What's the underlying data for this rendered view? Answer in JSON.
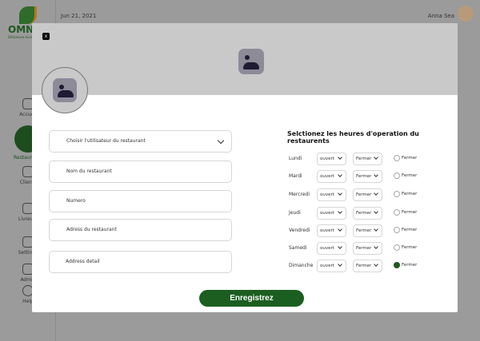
{
  "brand": {
    "name": "OMNIFOOD",
    "tagline": "Délicieuse livraison"
  },
  "sidebar": {
    "items": [
      {
        "label": "Accueil"
      },
      {
        "label": "Restaurants"
      },
      {
        "label": "Clients"
      },
      {
        "label": "Livreurs"
      },
      {
        "label": "Settings"
      },
      {
        "label": "Admin"
      },
      {
        "label": "Help"
      }
    ]
  },
  "topbar": {
    "date": "Jun 21, 2021",
    "user": "Anna Sea"
  },
  "modal": {
    "close_label": "x",
    "fields": [
      {
        "label": "Choisir l'utilisateur du restaurant",
        "dropdown": true
      },
      {
        "label": "Nom du restaurant"
      },
      {
        "label": "Numero"
      },
      {
        "label": "Adress du restaurant"
      },
      {
        "label": "Address detail"
      }
    ],
    "hours_title": "Selctionez les heures d'operation du restaurents",
    "days": [
      {
        "day": "Lundi",
        "open": "ouvert",
        "close": "Fermer",
        "closed_label": "Fermer",
        "closed": false
      },
      {
        "day": "Mardi",
        "open": "ouvert",
        "close": "Fermer",
        "closed_label": "Fermer",
        "closed": false
      },
      {
        "day": "Mercredi",
        "open": "ouvert",
        "close": "Fermer",
        "closed_label": "Fermer",
        "closed": false
      },
      {
        "day": "Jeudi",
        "open": "ouvert",
        "close": "Fermer",
        "closed_label": "Fermer",
        "closed": false
      },
      {
        "day": "Vendredi",
        "open": "ouvert",
        "close": "Fermer",
        "closed_label": "Fermer",
        "closed": false
      },
      {
        "day": "Samedi",
        "open": "ouvert",
        "close": "Fermer",
        "closed_label": "Fermer",
        "closed": false
      },
      {
        "day": "Dimanche",
        "open": "ouvert",
        "close": "Fermer",
        "closed_label": "Fermer",
        "closed": true
      }
    ],
    "save_label": "Enregistrez"
  },
  "colors": {
    "accent": "#1b5e20",
    "overlay": "#9b9b9b"
  }
}
